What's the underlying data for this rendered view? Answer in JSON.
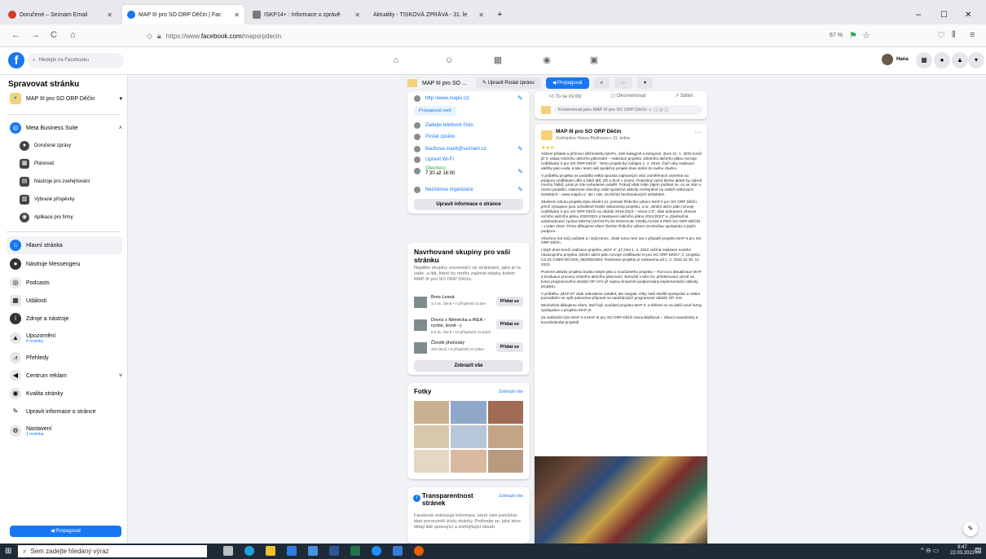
{
  "browser": {
    "tabs": [
      {
        "label": "Doručené – Seznam Email",
        "color": "#d33c2b"
      },
      {
        "label": "MAP III pro SO ORP Děčín | Fac",
        "color": "#1877f2"
      },
      {
        "label": "ISKP14+ : Informace o zprávě",
        "color": "#7a7a7a"
      },
      {
        "label": "Aktuality - TISKOVÁ ZPRÁVA - 31. le",
        "color": "#7a7a7a"
      }
    ],
    "new_tab": "+",
    "url_prefix": "https://www.",
    "url_domain": "facebook.com",
    "url_path": "/maporpdecin",
    "zoom": "67 %",
    "win_min": "–",
    "win_max": "☐",
    "win_close": "✕",
    "back": "←",
    "forward": "→",
    "reload": "C",
    "home": "⌂"
  },
  "fb": {
    "search_placeholder": "Hledejte na Facebooku",
    "user_name": "Hana"
  },
  "sidebar": {
    "title": "Spravovat stránku",
    "page_name": "MAP III pro SO ORP Děčín",
    "meta_title": "Meta Business Suite",
    "meta_items": [
      "Doručené zprávy",
      "Plánovač",
      "Nástroje pro zveřejňování",
      "Vybrané příspěvky",
      "Aplikace pro firmy"
    ],
    "items": [
      {
        "label": "Hlavní stránka",
        "sub": ""
      },
      {
        "label": "Nástroje Messengeru",
        "sub": ""
      },
      {
        "label": "Podcasts",
        "sub": ""
      },
      {
        "label": "Události",
        "sub": ""
      },
      {
        "label": "Zdroje a nástroje",
        "sub": ""
      },
      {
        "label": "Upozornění",
        "sub": "4 novinky"
      },
      {
        "label": "Přehledy",
        "sub": ""
      },
      {
        "label": "Centrum reklam",
        "sub": ""
      },
      {
        "label": "Kvalita stránky",
        "sub": ""
      },
      {
        "label": "Upravit informace o stránce",
        "sub": ""
      },
      {
        "label": "Nastavení",
        "sub": "1 novinka"
      }
    ],
    "promote": "Propagovat"
  },
  "pagebar": {
    "name": "MAP III pro SO ...",
    "edit": "Upravit Poslat zprávu",
    "promote": "Propagovat"
  },
  "about": {
    "website": "http://www.mapiii.cz/",
    "promote_web": "Propagovat web",
    "phone": "Zadejte telefonní číslo",
    "send_msg": "Poslat zprávu",
    "email": "blazkova.mas6@seznam.cz",
    "wifi": "Upravit Wi-Fi",
    "open": "Otevřeno",
    "hours": "7:30 až 16:00",
    "type": "Neziskova organizace",
    "edit_info": "Upravit informace o stránce"
  },
  "groups": {
    "title": "Navrhované skupiny pro vaši stránku",
    "desc": "Najděte skupiny související se stránkami, jako je ta vaše, a lidi, které by mohly zajímat otázky kolem MAP III pro SO ORP Děčín.",
    "list": [
      {
        "name": "Brno-Lesná",
        "meta": "3,4 tis. členů • 7 příspěvků za den"
      },
      {
        "name": "Dovoz z Německa a IKEA – rychle, levně :-)",
        "meta": "8,6 tis. členů • 10 příspěvků za týden"
      },
      {
        "name": "Člověk jihočeský",
        "meta": "483 členů • 6 příspěvků za týden"
      }
    ],
    "add": "Přidat se",
    "show_all": "Zobrazit vše"
  },
  "photos": {
    "title": "Fotky",
    "show_all": "Zobrazit vše"
  },
  "transparency": {
    "title": "Transparentnost stránek",
    "show_all": "Zobrazit vše",
    "text": "Facebook zobrazuje informace, které vám pomůžou lépe porozumět účelu stránky. Podívejte se, jaké akce dělají lidé spravující a zveřejňující obsah."
  },
  "actions": {
    "like": "To se mi líbí",
    "comment": "Okomentovat",
    "share": "Sdílet",
    "comment_as": "Komentovat jako MAP III pro SO ORP Děčín"
  },
  "post": {
    "author": "MAP III pro SO ORP Děčín",
    "meta": "Zveřejněno Hanou Blažkovou • 31. ledna",
    "paras": [
      "Vážení přátelé a příznivci děčínského MAPu, milé kolegyně a kolegové, dnes 31. 1. 2022 končí již II. etapa místního akčního plánování – realizace projektu „Místního akčního plánu rozvoje vzdělávání II pro SO ORP Děčín“. Tento projekt byl zahájen 1. 2. 2018. Čtyři roky realizace uběhly jako voda, a tak i tento náš společný projekt dnes došel do svého závěru.",
      "V průběhu projektu se podařila velká spousta zajímavých věcí zaměřených zejména na podporu vzdělávání dětí a žáků MŠ, ZŠ a ZUŠ v území. Podrobný výčet těchto aktivit by zabral mnoho řádků, proto je zde nebudeme uvádět. Pokud však máte zájem podívat se, co se nám v území podařilo, naleznete všechny naše společné aktivity zveřejněné na našich webových stránkách – www.mapiii.cz, ale i zde, na těchto facebookových stránkách.",
      "Závěrem tohoto projektu bylo dnešní 12. jednání Řídicího výboru MAP II pro SO ORP Děčín, jehož výstupem jsou schválené finální dokumenty projektu, a to: „Místní akční plán rozvoje vzdělávání II pro SO ORP Děčín na období 2018-2023 – Verze 2.0“, dále dokument „Revize ročního akčního plánu 2020/2021 a Nastavení akčního plánu 2021/2023“ a „Závěrečná sebehodnoticí zpráva MÍSTNÍ AKČNÍ PLÁN ROZVOJE VZDĚLÁVÁNÍ II PRO SO ORP DĚČÍN – Leden 2022. Tímto děkujeme všem členům Řídicího výboru za skvělou spolupráci a jejich podporu.",
      "Všechno má svůj začátek a i svůj konec. Jinak tomu není ani v případě projektu MAP II pro SO ORP Děčín.",
      "I když dnes končí realizace projektu „MAP II“, již zítra 1. 2. 2022 začíná realizace nového navazujícího projektu „Místní akční plán rozvoje vzdělávání III pro SO ORP Děčín“, č. projektu: CZ.02.3.68/0.0/0.0/20_082/0021553. Realizace projektu je nastavena od 1. 2. 2022 do 30. 11. 2023.",
      "Povinné aktivity projektu budou stejné jako u současného projektu – Rozvoj a aktualizace MAP a Evaluace procesu místního akčního plánování. Bohužel v této tzv. překlenovací výzvě na konci programového období OP VVV již nejsou finančně podporovány implementační aktivity projektu.",
      "V průběhu „MAP III“ však nebudeme zahálet, ale naopak. Díky Vaší skvělé spolupráci a Vašim poznatkům se opět pokusíme připravit na nadcházející programové období OP JAK.",
      "Mnohokrát děkujeme všem, kteří byli součástí projektu MAP II, a těšíme se na další nové formy spolupráce v projektu MAP III.",
      "Za realizační tým MAP II a MAP III pro SO ORP Děčín Hana Blažková – Hlavní manažerka a koordinátorka projektů"
    ]
  },
  "taskbar": {
    "search": "Sem zadejte hledaný výraz",
    "time": "9:47",
    "date": "22.03.2022"
  },
  "colors": {
    "fb_blue": "#1877f2",
    "taskbar": "#1f2a37"
  }
}
